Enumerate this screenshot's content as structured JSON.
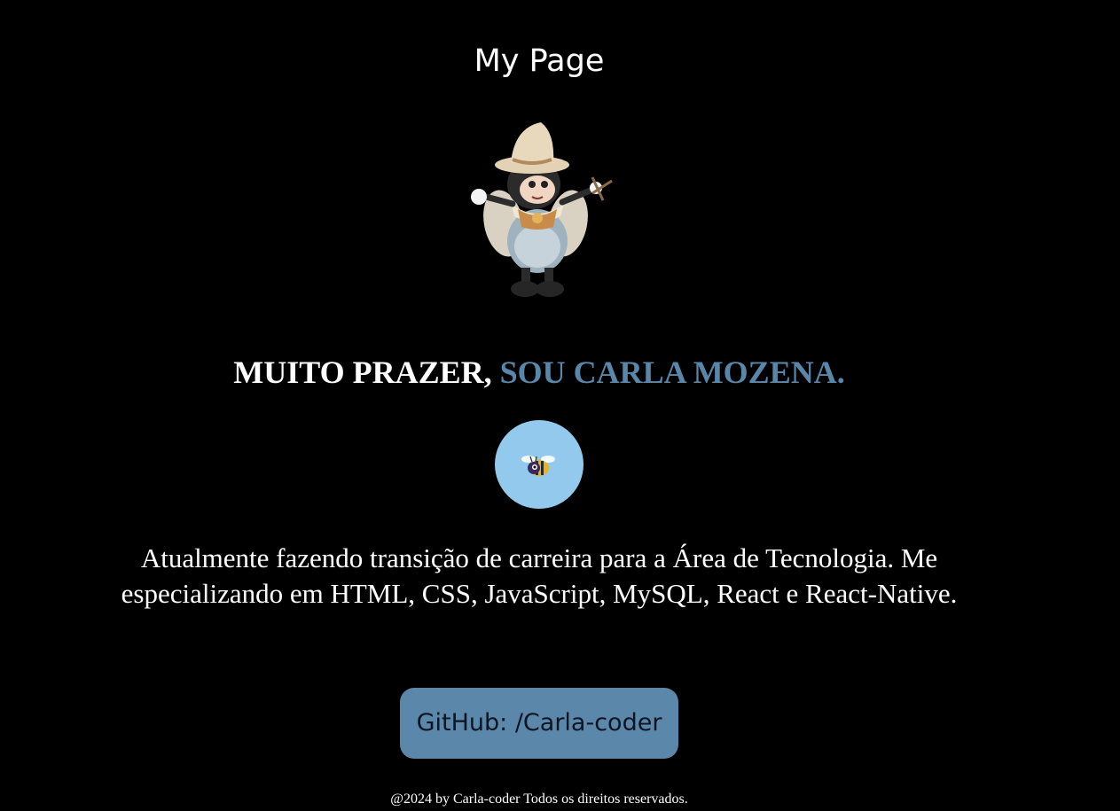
{
  "page": {
    "title": "My Page",
    "background_color": "#000000"
  },
  "hero": {
    "image_icon": "bee-mascot-illustration",
    "greeting_prefix": "MUITO PRAZER, ",
    "greeting_name": "SOU CARLA MOZENA.",
    "accent_color": "#5a86aa"
  },
  "badge": {
    "icon": "bee-icon",
    "circle_color": "#93c9ec"
  },
  "bio": {
    "text": "Atualmente fazendo transição de carreira para a Área de Tecnologia. Me especializando em HTML, CSS, JavaScript, MySQL, React e React-Native."
  },
  "github_button": {
    "label": "GitHub: /Carla-coder",
    "color": "#5b87aa"
  },
  "footer": {
    "text": "@2024 by Carla-coder Todos os direitos reservados."
  }
}
